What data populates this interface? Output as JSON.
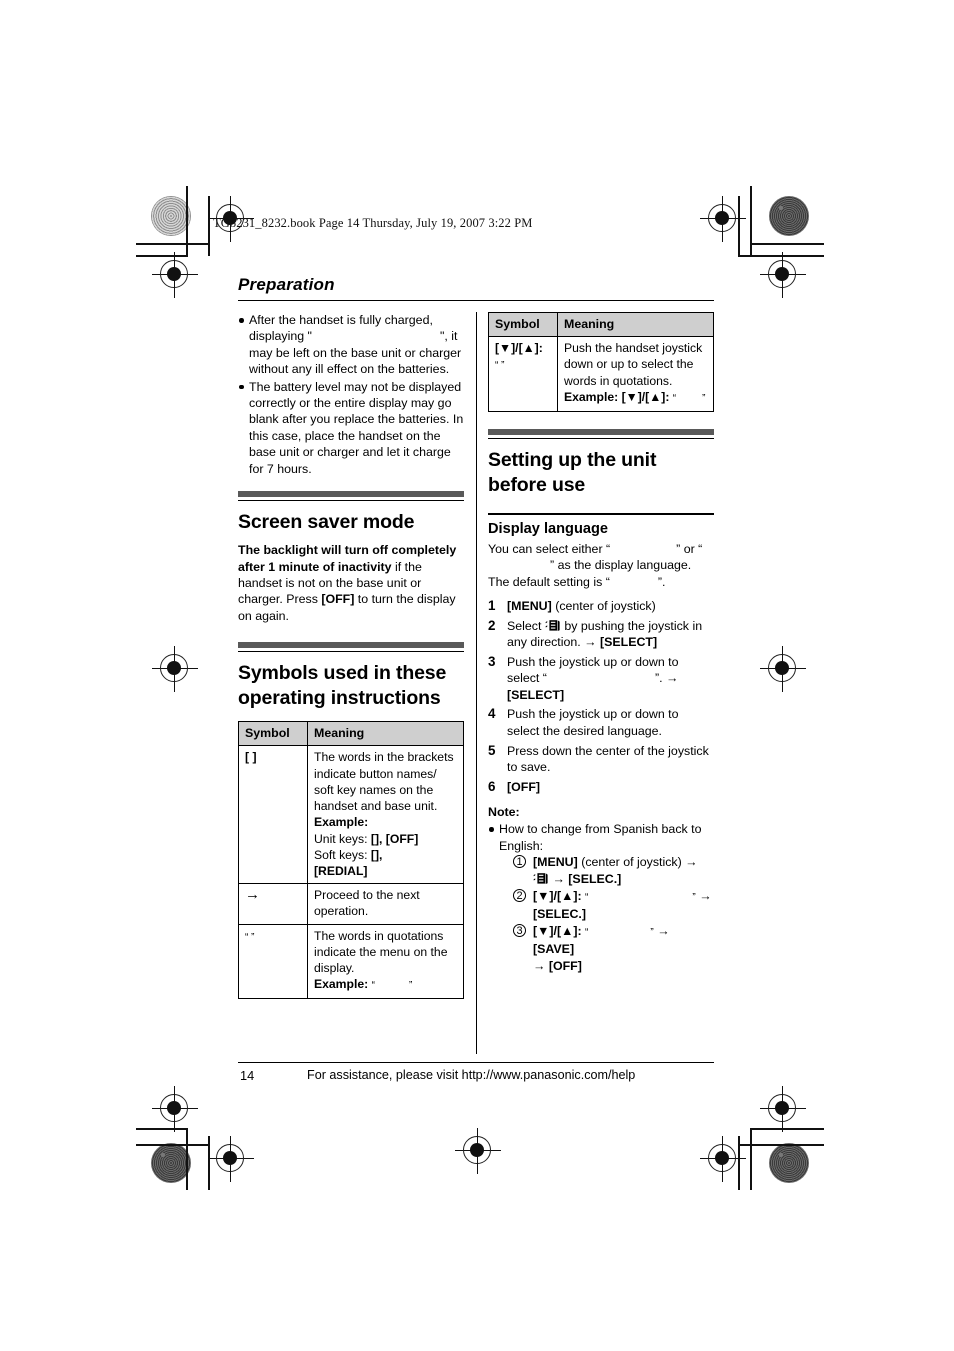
{
  "document": {
    "filestamp": "TG8231_8232.book  Page 14  Thursday, July 19, 2007  3:22 PM",
    "section_title": "Preparation",
    "footer": {
      "page_number": "14",
      "assistance": "For assistance, please visit http://www.panasonic.com/help"
    }
  },
  "left_column": {
    "intro_bullets": [
      {
        "prefix": "After the handset is fully charged, displaying \"",
        "quoted": "",
        "suffix": "\", it may be left on the base unit or charger without any ill effect on the batteries."
      },
      {
        "prefix": "The battery level may not be displayed correctly or the entire display may go blank after you replace the batteries. In this case, place the handset on the base unit or charger and let it charge for 7 hours.",
        "quoted": "",
        "suffix": ""
      }
    ],
    "screen_saver": {
      "heading": "Screen saver mode",
      "bold_lead": "The backlight will turn off completely after 1 minute of inactivity",
      "rest_1": " if the handset is not on the base unit or charger. Press ",
      "key_off": "{OFF}",
      "rest_2": " to turn the display on again."
    },
    "symbols_section": {
      "heading": "Symbols used in these operating instructions",
      "table": {
        "headers": [
          "Symbol",
          "Meaning"
        ],
        "rows": [
          {
            "symbol": "{ }",
            "meaning_lines": [
              "The words in the brackets indicate button names/ soft key names on the handset and base unit."
            ],
            "example_label": "Example:",
            "example_unit_keys_label": "Unit keys: ",
            "example_unit_keys_suffix": ", {OFF}",
            "example_soft_keys_label": "Soft keys: ",
            "example_soft_keys_suffix": ",",
            "example_redial": "{REDIAL}"
          },
          {
            "symbol": "→",
            "meaning_lines": [
              "Proceed to the next operation."
            ]
          },
          {
            "symbol": "“ ”",
            "meaning_lines": [
              "The words in quotations indicate the menu on the display."
            ],
            "example_label": "Example:",
            "example_quoted": ""
          }
        ]
      }
    }
  },
  "right_column": {
    "joystick_table": {
      "headers": [
        "Symbol",
        "Meaning"
      ],
      "row": {
        "symbol_line1": "{▼}/{▲}:",
        "symbol_line2": "“ ”",
        "meaning": "Push the handset joystick down or up to select the words in quotations.",
        "example_label": "Example:",
        "example_keys": "{▼}/{▲}: ",
        "example_quoted": ""
      }
    },
    "setup_section": {
      "heading": "Setting up the unit before use",
      "display_language": {
        "heading": "Display language",
        "intro_1": "You can select either “",
        "intro_option_1": "",
        "intro_2": "” or “",
        "intro_option_2": "",
        "intro_3": "” as the display language. The default setting is “",
        "intro_default": "",
        "intro_4": "”.",
        "steps": [
          {
            "num": "1",
            "key": "{MENU}",
            "text": " (center of joystick)"
          },
          {
            "num": "2",
            "text_before_icon": "Select ",
            "icon": "settings-icon",
            "text_after_icon": " by pushing the joystick in any direction. ",
            "arrow": "→",
            "key_end": "{SELECT}"
          },
          {
            "num": "3",
            "text_before": "Push the joystick up or down to select “",
            "quoted": "",
            "text_after": "”. ",
            "arrow": "→",
            "key_end": "{SELECT}"
          },
          {
            "num": "4",
            "text": "Push the joystick up or down to select the desired language."
          },
          {
            "num": "5",
            "text": "Press down the center of the joystick to save."
          },
          {
            "num": "6",
            "key": "{OFF}"
          }
        ],
        "note": {
          "label": "Note:",
          "bullet": "How to change from Spanish back to English:",
          "substeps": [
            {
              "num": "①",
              "key1": "{MENU}",
              "text": " (center of joystick) ",
              "arrow1": "→",
              "icon": "settings-icon",
              "arrow2": "→",
              "key2": "{SELEC.}"
            },
            {
              "num": "②",
              "key1": "{▼}/{▲}: ",
              "quoted": "",
              "arrow1": "→",
              "key2": "{SELEC.}"
            },
            {
              "num": "③",
              "key1": "{▼}/{▲}: ",
              "quoted": "",
              "arrow1": "→",
              "key2": "{SAVE}",
              "arrow2": "→",
              "key3": "{OFF}"
            }
          ]
        }
      }
    }
  },
  "colors": {
    "table_header_bg": "#cfcfcf",
    "rule_grey": "#595959",
    "text": "#000000"
  }
}
